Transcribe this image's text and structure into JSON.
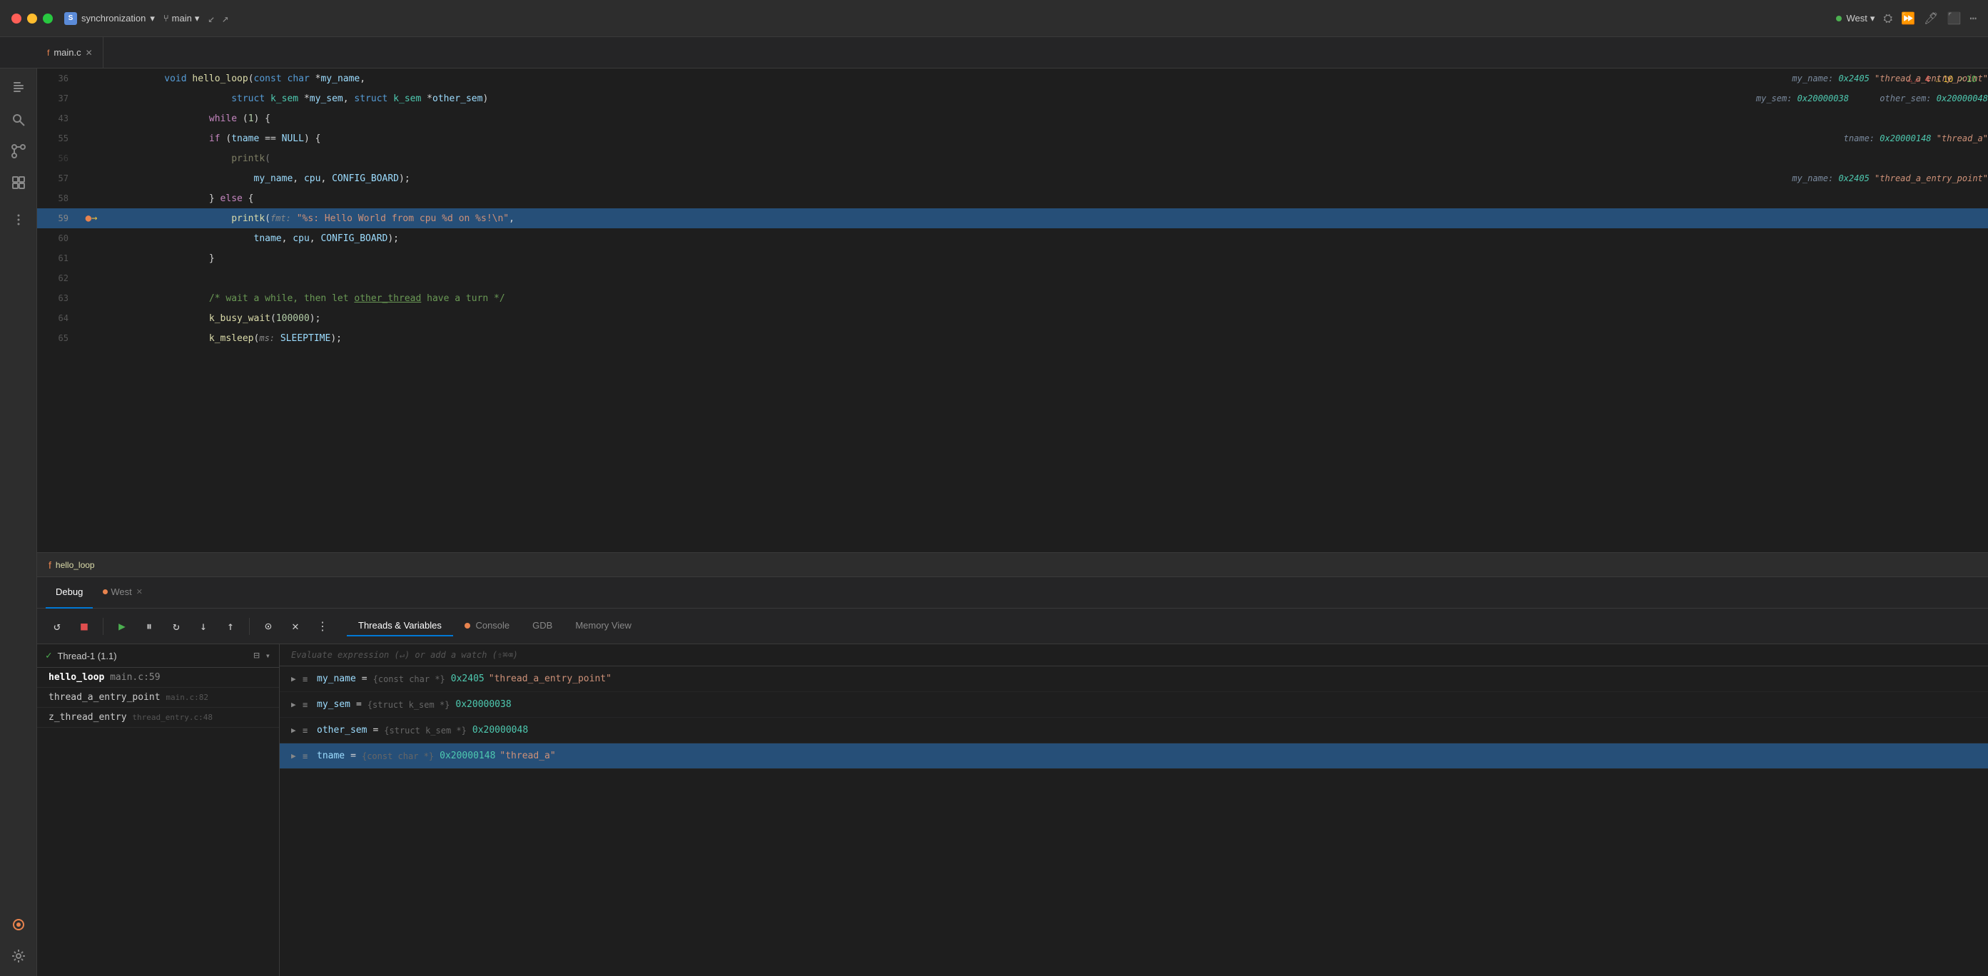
{
  "titlebar": {
    "project_icon_text": "S",
    "project_name": "synchronization",
    "branch_name": "main",
    "user_name": "West",
    "expand_label": "↙ ↗"
  },
  "tabs": [
    {
      "icon": "f",
      "label": "main.c",
      "closeable": true
    }
  ],
  "code": {
    "breadcrumb_fn": "hello_loop",
    "lines": [
      {
        "num": "36",
        "gutter": "",
        "content": "    void hello_loop(const char *my_name,",
        "hint": "my_name: 0x2405 \"thread_a_entry_point\""
      },
      {
        "num": "37",
        "gutter": "",
        "content": "            struct k_sem *my_sem, struct k_sem *other_sem)",
        "hint": "my_sem: 0x20000038      other_sem: 0x20000048"
      },
      {
        "num": "43",
        "gutter": "",
        "content": "        while (1) {",
        "hint": ""
      },
      {
        "num": "55",
        "gutter": "",
        "content": "        if (tname == NULL) {",
        "hint": "tname: 0x20000148 \"thread_a\""
      },
      {
        "num": "56",
        "gutter": "",
        "content": "            printk(",
        "hint": ""
      },
      {
        "num": "57",
        "gutter": "",
        "content": "                my_name, cpu, CONFIG_BOARD);",
        "hint": "my_name: 0x2405 \"thread_a_entry_point\""
      },
      {
        "num": "58",
        "gutter": "",
        "content": "        } else {",
        "hint": ""
      },
      {
        "num": "59",
        "gutter": "bp_arrow",
        "content": "            printk(fmt: \"%s: Hello World from cpu %d on %s!\\n\",",
        "hint": "",
        "highlighted": true
      },
      {
        "num": "60",
        "gutter": "",
        "content": "                tname, cpu, CONFIG_BOARD);",
        "hint": ""
      },
      {
        "num": "61",
        "gutter": "",
        "content": "        }",
        "hint": ""
      },
      {
        "num": "62",
        "gutter": "",
        "content": "",
        "hint": ""
      },
      {
        "num": "63",
        "gutter": "",
        "content": "        /* wait a while, then let other_thread have a turn */",
        "hint": ""
      },
      {
        "num": "64",
        "gutter": "",
        "content": "        k_busy_wait(100000);",
        "hint": ""
      },
      {
        "num": "65",
        "gutter": "",
        "content": "        k_msleep(ms: SLEEPTIME);",
        "hint": ""
      }
    ]
  },
  "warnings": {
    "red": "⚠ 4",
    "yellow": "⚠ 10",
    "green": "✓ 10"
  },
  "debug": {
    "tabs": [
      "Debug",
      "West"
    ],
    "toolbar_buttons": [
      "↺",
      "■",
      "▶",
      "⏸",
      "↻",
      "↓",
      "↑",
      "⊙",
      "✕",
      "⋮"
    ],
    "inner_tabs": [
      "Threads & Variables",
      "Console",
      "GDB",
      "Memory View"
    ],
    "active_inner_tab": "Threads & Variables",
    "thread_name": "Thread-1 (1.1)",
    "eval_placeholder": "Evaluate expression (↵) or add a watch (⇧⌘⌫)",
    "call_stack": [
      {
        "fn": "hello_loop",
        "file": "main.c:59"
      },
      {
        "fn": "thread_a_entry_point",
        "file": "main.c:82"
      },
      {
        "fn": "z_thread_entry",
        "file": "thread_entry.c:48"
      }
    ],
    "variables": [
      {
        "name": "my_name",
        "eq": "=",
        "type": "{const char *}",
        "value": "0x2405 \"thread_a_entry_point\"",
        "selected": false
      },
      {
        "name": "my_sem",
        "eq": "=",
        "type": "{struct k_sem *}",
        "value": "0x20000038",
        "selected": false
      },
      {
        "name": "other_sem",
        "eq": "=",
        "type": "{struct k_sem *}",
        "value": "0x20000048",
        "selected": false
      },
      {
        "name": "tname",
        "eq": "=",
        "type": "{const char *}",
        "value": "0x20000148 \"thread_a\"",
        "selected": true
      }
    ]
  }
}
